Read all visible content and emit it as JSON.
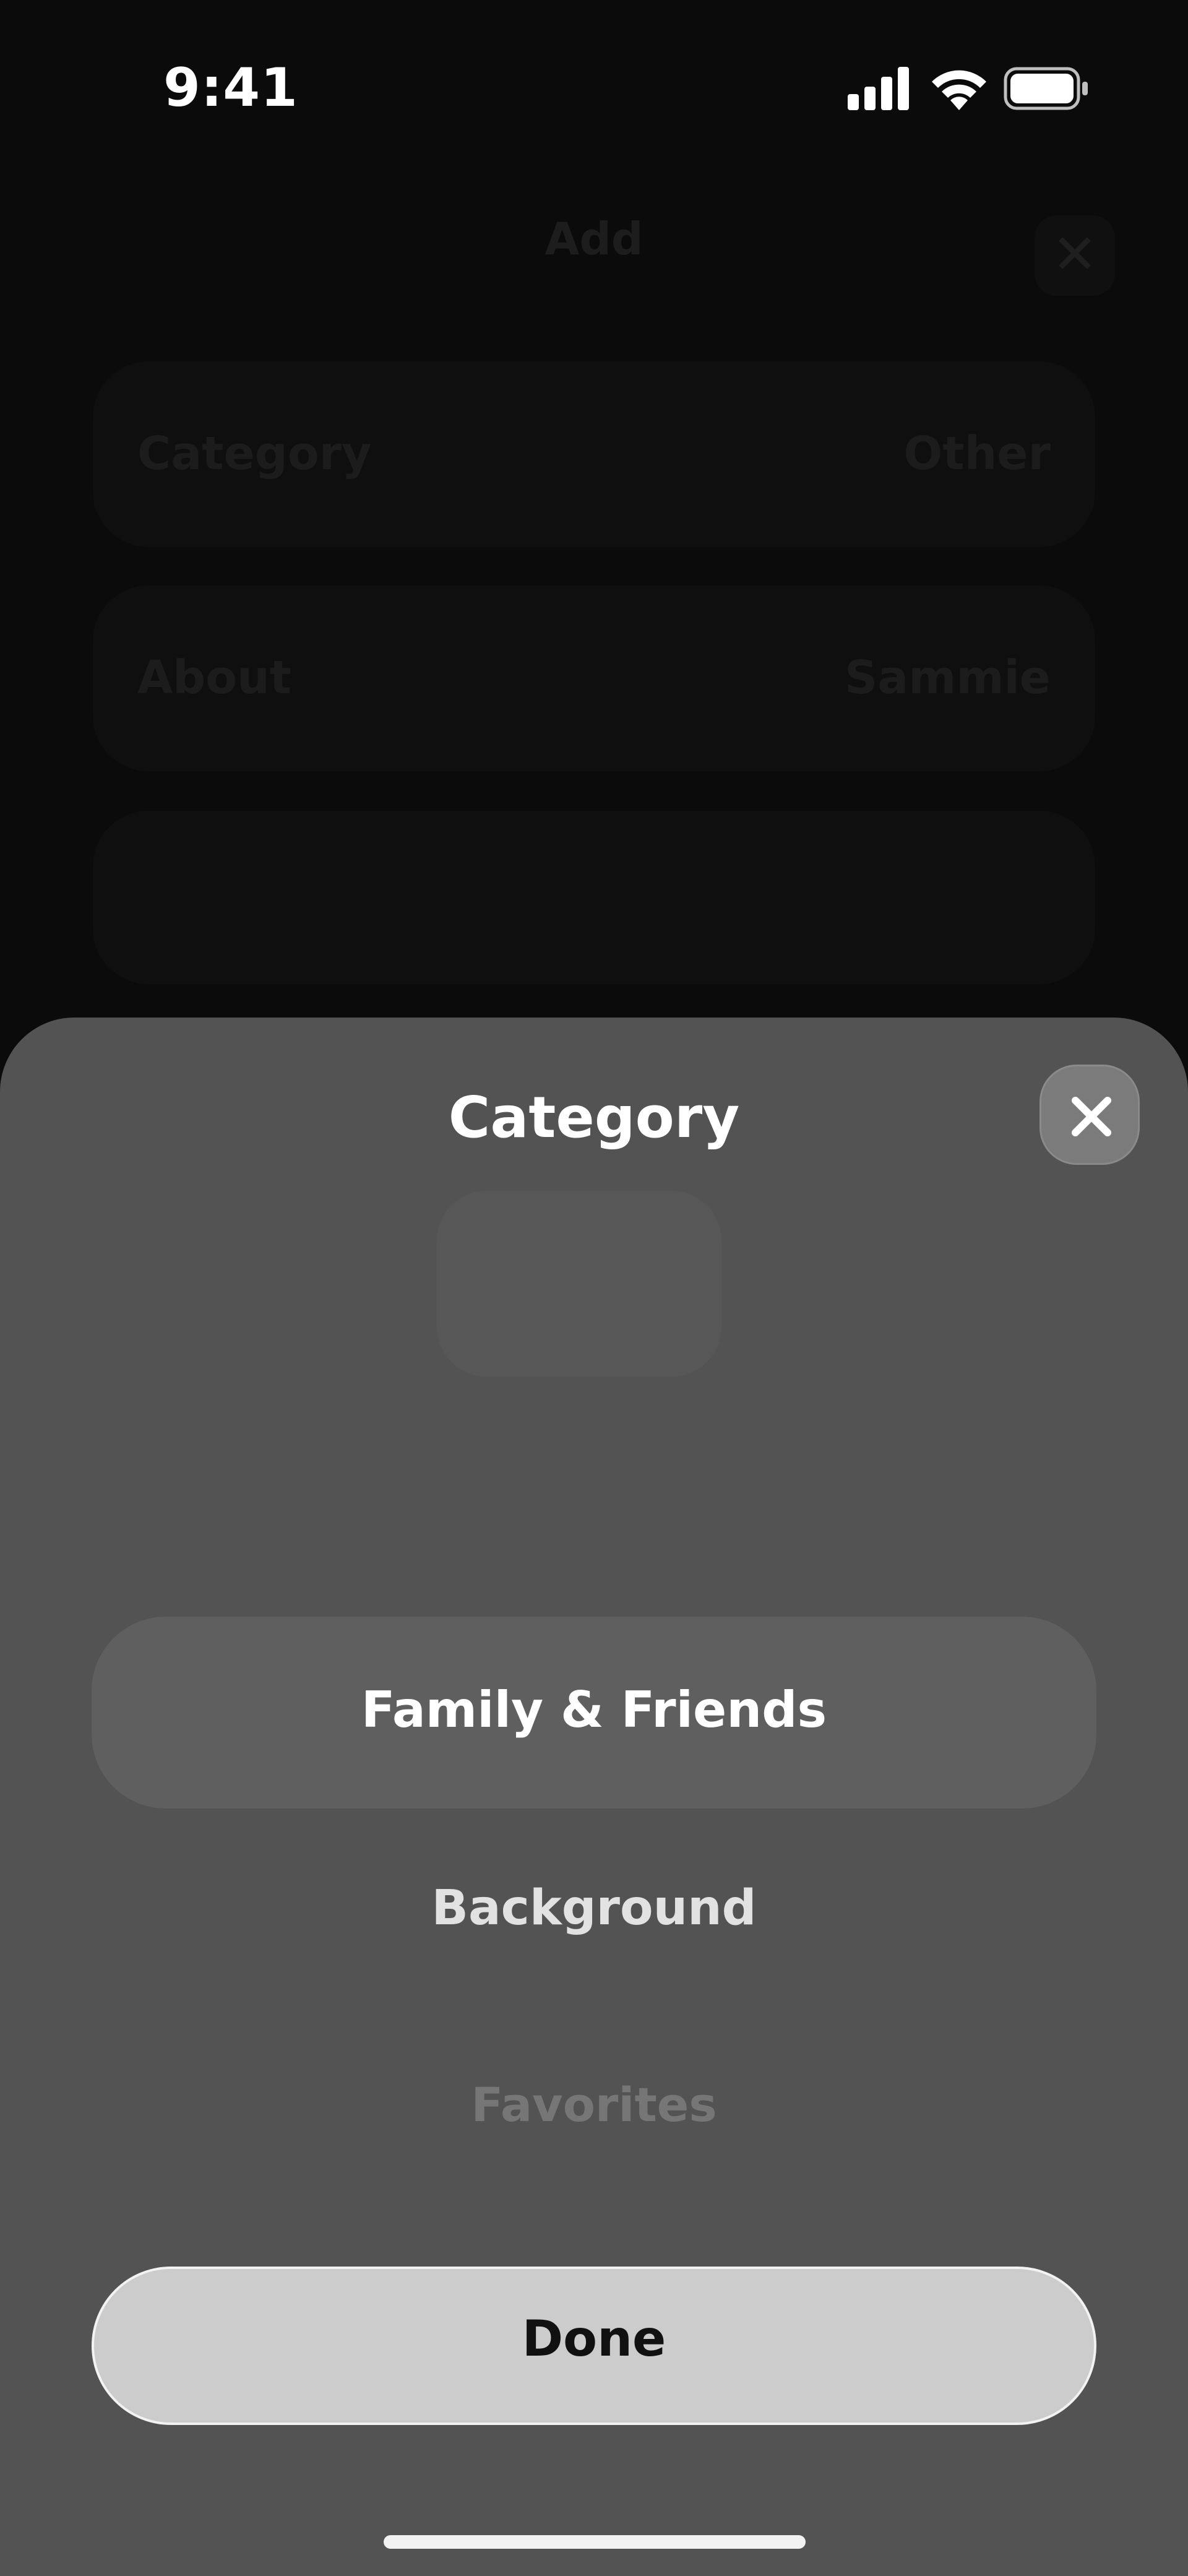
{
  "status_bar": {
    "time": "9:41"
  },
  "background_screen": {
    "title": "Add",
    "close_icon": "close-icon",
    "rows": [
      {
        "label": "Category",
        "value": "Other"
      },
      {
        "label": "About",
        "value": "Sammie"
      }
    ]
  },
  "sheet": {
    "title": "Category",
    "close_icon": "close-icon",
    "picker": {
      "selected": "Family & Friends",
      "options": [
        "Family & Friends",
        "Background",
        "Favorites"
      ]
    },
    "done_label": "Done"
  },
  "colors": {
    "sheet_background": "#535353",
    "selected_row": "#5f5f5f",
    "done_button": "#cccccc",
    "screen_background": "#0b0b0b"
  }
}
